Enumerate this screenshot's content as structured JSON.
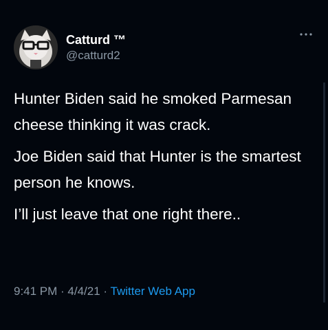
{
  "user": {
    "display_name": "Catturd ™",
    "handle": "@catturd2"
  },
  "tweet": {
    "paragraphs": [
      "Hunter Biden said he smoked Parmesan cheese thinking it was crack.",
      "Joe Biden said that Hunter is the smartest person he knows.",
      "I’ll just leave that one right there.."
    ],
    "time": "9:41 PM",
    "separator": " · ",
    "date": "4/4/21",
    "source": "Twitter Web App"
  },
  "icons": {
    "more": "more-horizontal-icon",
    "avatar": "cat-with-glasses-avatar"
  },
  "colors": {
    "background": "#02060d",
    "primary_text": "#ffffff",
    "secondary_text": "#8b98a5",
    "link": "#1d9bf0"
  }
}
